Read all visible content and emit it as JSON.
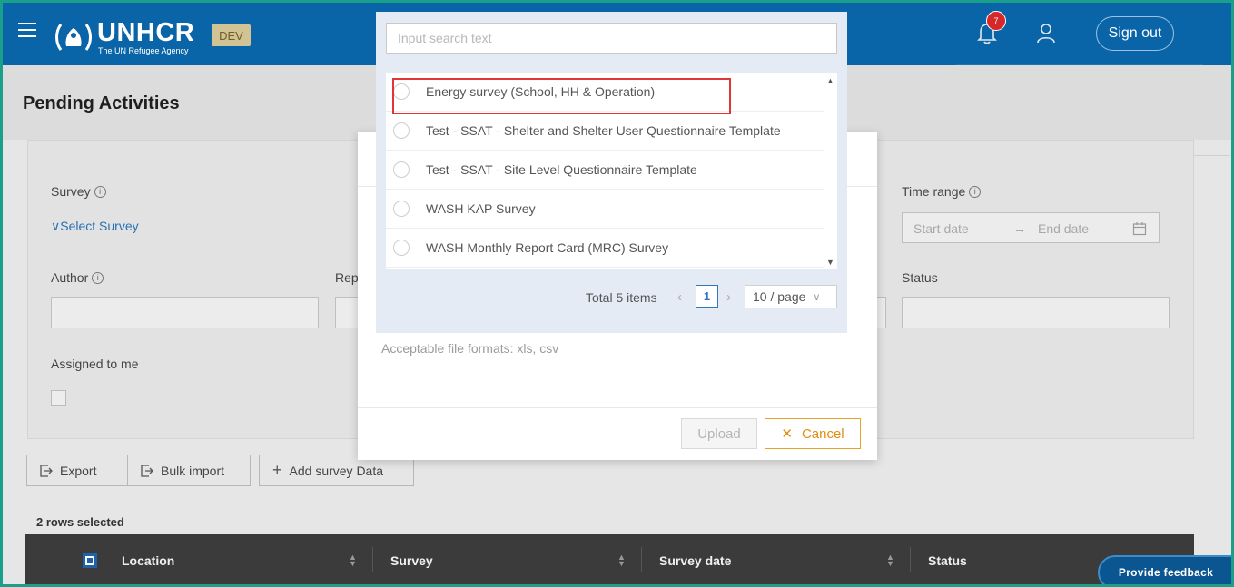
{
  "header": {
    "brand": "UNHCR",
    "brand_sub": "The UN Refugee Agency",
    "env_badge": "DEV",
    "notification_count": "7",
    "signout_label": "Sign out"
  },
  "page": {
    "title": "Pending Activities"
  },
  "filters": {
    "survey_label": "Survey",
    "select_survey": "Select Survey",
    "time_range_label": "Time range",
    "start_date_placeholder": "Start date",
    "end_date_placeholder": "End date",
    "author_label": "Author",
    "rep_label": "Rep",
    "status_label": "Status",
    "assigned_label": "Assigned to me"
  },
  "actions": {
    "export": "Export",
    "bulk_import": "Bulk import",
    "add_survey": "Add survey Data"
  },
  "table": {
    "rows_selected": "2 rows selected",
    "columns": [
      "Location",
      "Survey",
      "Survey date",
      "Status"
    ]
  },
  "feedback_label": "Provide feedback",
  "modal": {
    "formats_note": "Acceptable file formats: xls, csv",
    "upload_label": "Upload",
    "cancel_label": "Cancel"
  },
  "dropdown": {
    "search_placeholder": "Input search text",
    "items": [
      "Energy survey (School, HH & Operation)",
      "Test - SSAT - Shelter and Shelter User Questionnaire Template",
      "Test - SSAT - Site Level Questionnaire Template",
      "WASH KAP Survey",
      "WASH Monthly Report Card (MRC) Survey"
    ],
    "total": "Total 5 items",
    "current_page": "1",
    "page_size": "10 / page"
  },
  "colors": {
    "header_bg": "#0a65a8",
    "accent_orange": "#e08d0d",
    "highlight_red": "#e0363a",
    "link_blue": "#2672b4"
  }
}
